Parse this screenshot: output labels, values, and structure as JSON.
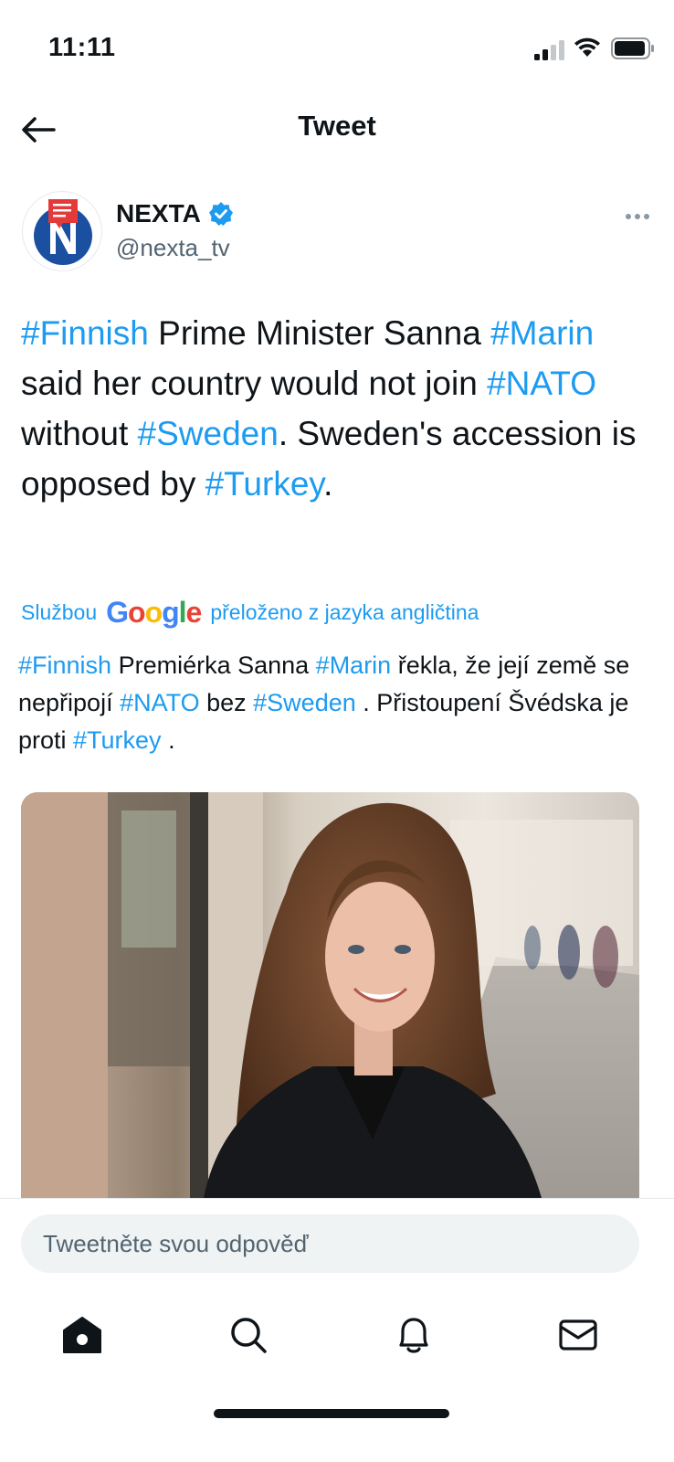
{
  "status_bar": {
    "time": "11:11"
  },
  "header": {
    "title": "Tweet"
  },
  "author": {
    "name": "NEXTA",
    "handle": "@nexta_tv"
  },
  "tweet": {
    "segments": [
      {
        "text": "#Finnish",
        "hashtag": true
      },
      {
        "text": " Prime Minister Sanna ",
        "hashtag": false
      },
      {
        "text": "#Marin",
        "hashtag": true
      },
      {
        "text": " said her country would not join ",
        "hashtag": false
      },
      {
        "text": "#NATO",
        "hashtag": true
      },
      {
        "text": " without ",
        "hashtag": false
      },
      {
        "text": "#Sweden",
        "hashtag": true
      },
      {
        "text": ". Sweden's accession is opposed by ",
        "hashtag": false
      },
      {
        "text": "#Turkey",
        "hashtag": true
      },
      {
        "text": ".",
        "hashtag": false
      }
    ]
  },
  "translation": {
    "prefix": "Službou",
    "google_letters": [
      "G",
      "o",
      "o",
      "g",
      "l",
      "e"
    ],
    "suffix": "přeloženo z jazyka angličtina",
    "segments": [
      {
        "text": "#Finnish",
        "hashtag": true
      },
      {
        "text": " Premiérka Sanna ",
        "hashtag": false
      },
      {
        "text": "#Marin",
        "hashtag": true
      },
      {
        "text": " řekla, že její země se nepřipojí ",
        "hashtag": false
      },
      {
        "text": "#NATO",
        "hashtag": true
      },
      {
        "text": " bez ",
        "hashtag": false
      },
      {
        "text": "#Sweden",
        "hashtag": true
      },
      {
        "text": " . Přistoupení Švédska je proti ",
        "hashtag": false
      },
      {
        "text": "#Turkey",
        "hashtag": true
      },
      {
        "text": " .",
        "hashtag": false
      }
    ]
  },
  "reply": {
    "placeholder": "Tweetněte svou odpověď"
  },
  "nav": {
    "items": [
      "home-icon",
      "search-icon",
      "bell-icon",
      "mail-icon"
    ]
  },
  "colors": {
    "accent": "#1d9bf0",
    "text": "#0f1419",
    "secondary": "#536471"
  }
}
